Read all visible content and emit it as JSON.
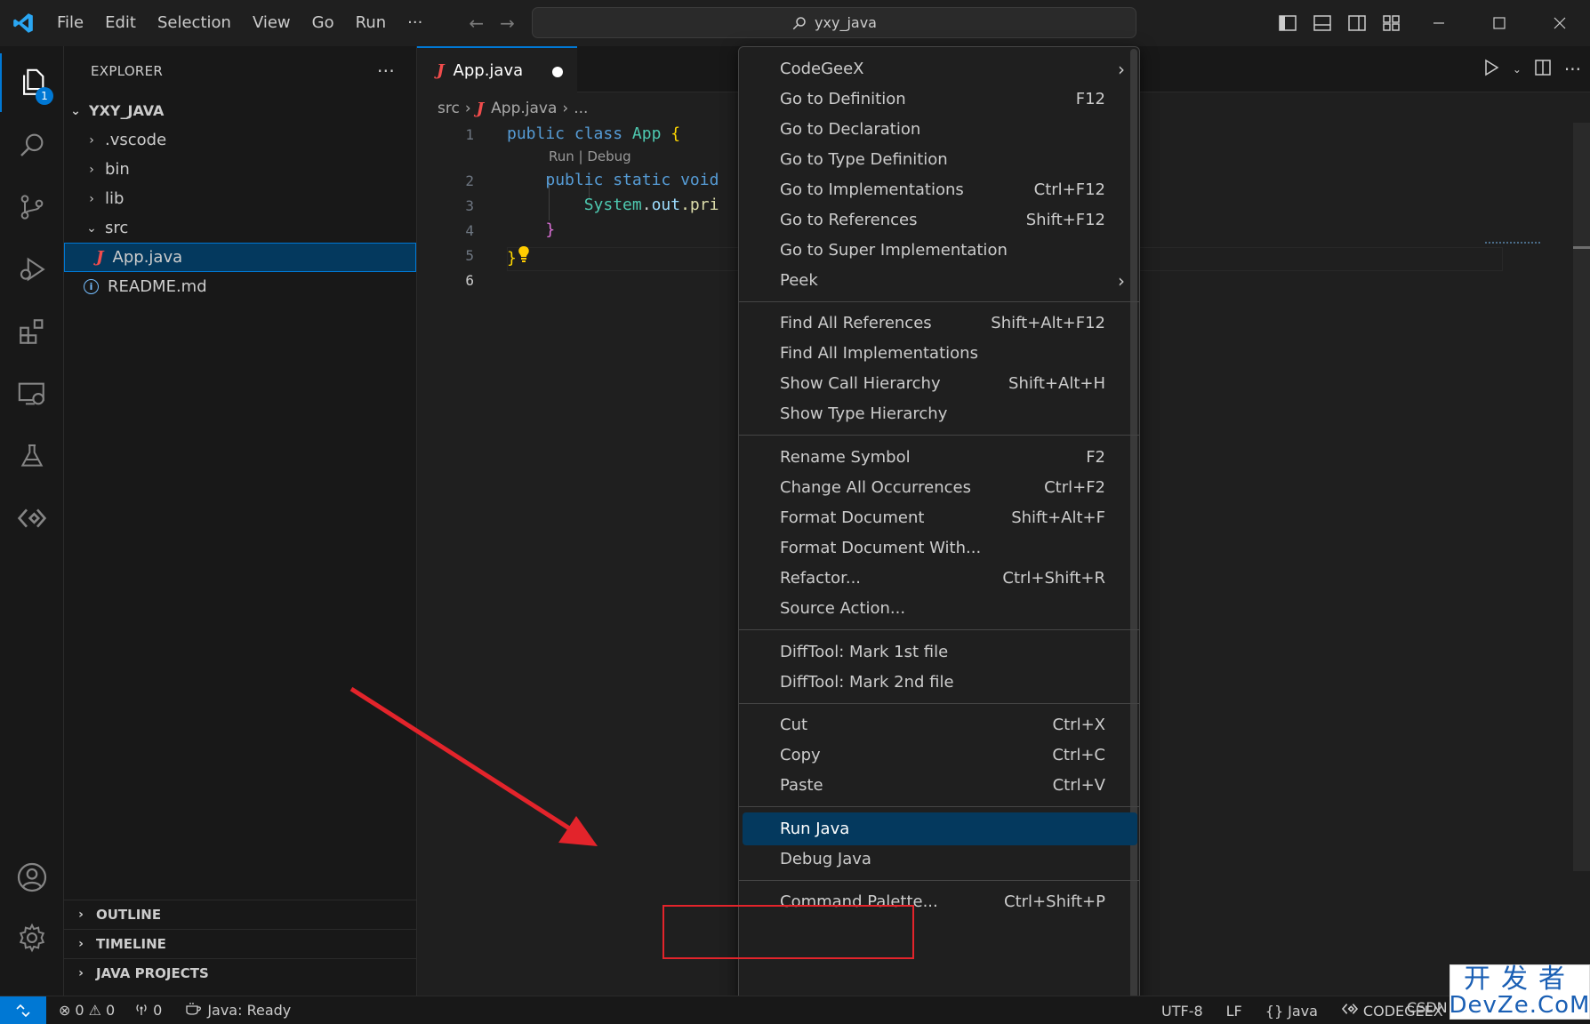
{
  "titlebar": {
    "menu": [
      "File",
      "Edit",
      "Selection",
      "View",
      "Go",
      "Run",
      "···"
    ],
    "search": "yxy_java"
  },
  "activitybar": {
    "explorer_badge": "1"
  },
  "sidebar": {
    "title": "EXPLORER",
    "more": "···",
    "root": "YXY_JAVA",
    "items": [
      {
        "label": ".vscode",
        "type": "folder",
        "expanded": false
      },
      {
        "label": "bin",
        "type": "folder",
        "expanded": false
      },
      {
        "label": "lib",
        "type": "folder",
        "expanded": false
      },
      {
        "label": "src",
        "type": "folder",
        "expanded": true
      },
      {
        "label": "App.java",
        "type": "java",
        "selected": true
      },
      {
        "label": "README.md",
        "type": "info"
      }
    ],
    "sections": [
      "OUTLINE",
      "TIMELINE",
      "JAVA PROJECTS"
    ]
  },
  "editor": {
    "tab_label": "App.java",
    "breadcrumb": {
      "folder": "src",
      "file": "App.java",
      "more": "..."
    },
    "line_numbers": [
      "1",
      "2",
      "3",
      "4",
      "5",
      "6"
    ],
    "codelens": "Run | Debug",
    "code": {
      "l1_kw": "public class ",
      "l1_cls": "App",
      "l1_brace": " {",
      "l2_kw": "public static void",
      "l3_cls": "System",
      "l3_dot": ".",
      "l3_var": "out",
      "l3_fn": ".pri",
      "l4_brace": "}",
      "l5_brace": "}"
    }
  },
  "context_menu": {
    "items": [
      {
        "label": "CodeGeeX",
        "key": "",
        "submenu": true
      },
      {
        "label": "Go to Definition",
        "key": "F12"
      },
      {
        "label": "Go to Declaration",
        "key": ""
      },
      {
        "label": "Go to Type Definition",
        "key": ""
      },
      {
        "label": "Go to Implementations",
        "key": "Ctrl+F12"
      },
      {
        "label": "Go to References",
        "key": "Shift+F12"
      },
      {
        "label": "Go to Super Implementation",
        "key": ""
      },
      {
        "label": "Peek",
        "key": "",
        "submenu": true
      },
      {
        "label": "Find All References",
        "key": "Shift+Alt+F12"
      },
      {
        "label": "Find All Implementations",
        "key": ""
      },
      {
        "label": "Show Call Hierarchy",
        "key": "Shift+Alt+H"
      },
      {
        "label": "Show Type Hierarchy",
        "key": ""
      },
      {
        "label": "Rename Symbol",
        "key": "F2"
      },
      {
        "label": "Change All Occurrences",
        "key": "Ctrl+F2"
      },
      {
        "label": "Format Document",
        "key": "Shift+Alt+F"
      },
      {
        "label": "Format Document With...",
        "key": ""
      },
      {
        "label": "Refactor...",
        "key": "Ctrl+Shift+R"
      },
      {
        "label": "Source Action...",
        "key": ""
      },
      {
        "label": "DiffTool: Mark 1st file",
        "key": ""
      },
      {
        "label": "DiffTool: Mark 2nd file",
        "key": ""
      },
      {
        "label": "Cut",
        "key": "Ctrl+X"
      },
      {
        "label": "Copy",
        "key": "Ctrl+C"
      },
      {
        "label": "Paste",
        "key": "Ctrl+V"
      },
      {
        "label": "Run Java",
        "key": "",
        "highlighted": true
      },
      {
        "label": "Debug Java",
        "key": ""
      },
      {
        "label": "Command Palette...",
        "key": "Ctrl+Shift+P"
      }
    ]
  },
  "statusbar": {
    "errors": "0",
    "warnings": "0",
    "ports": "0",
    "java_status": "Java: Ready",
    "encoding": "UTF-8",
    "eol": "LF",
    "language_braces": "{}",
    "language": "Java",
    "codegeex": "CODEGEEX",
    "csdn": "CSDN"
  },
  "watermark": {
    "top": "开发者",
    "bottom": "DevZe.CoM"
  },
  "colors": {
    "accent": "#0078d4",
    "highlight": "#04395e",
    "annotation": "#e3242b"
  }
}
